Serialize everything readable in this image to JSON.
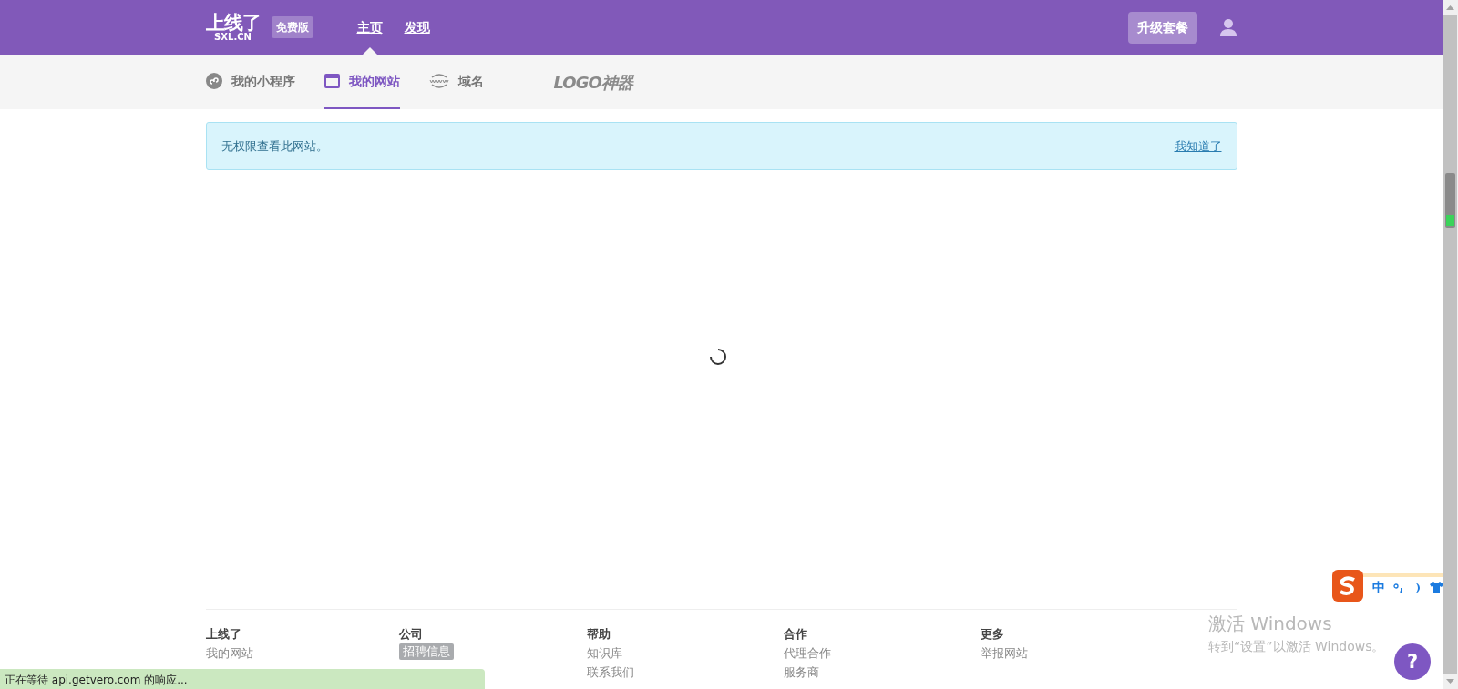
{
  "header": {
    "logo": "上线了",
    "logo_sub": "SXL.CN",
    "plan_badge": "免费版",
    "nav": [
      {
        "label": "主页",
        "selected": true
      },
      {
        "label": "发现",
        "selected": false
      }
    ],
    "upgrade_button": "升级套餐"
  },
  "subnav": {
    "items": [
      {
        "label": "我的小程序",
        "kind": "miniprogram",
        "selected": false
      },
      {
        "label": "我的网站",
        "kind": "website",
        "selected": true
      },
      {
        "label": "域名",
        "kind": "domain",
        "selected": false
      }
    ],
    "logo_tool": "LOGO神器"
  },
  "alert": {
    "message": "无权限查看此网站。",
    "dismiss": "我知道了"
  },
  "footer": {
    "columns": [
      {
        "heading": "上线了",
        "links": [
          {
            "label": "我的网站",
            "highlighted": false
          }
        ]
      },
      {
        "heading": "公司",
        "links": [
          {
            "label": "招聘信息",
            "highlighted": true
          }
        ]
      },
      {
        "heading": "帮助",
        "links": [
          {
            "label": "知识库",
            "highlighted": false
          },
          {
            "label": "联系我们",
            "highlighted": false
          }
        ]
      },
      {
        "heading": "合作",
        "links": [
          {
            "label": "代理合作",
            "highlighted": false
          },
          {
            "label": "服务商",
            "highlighted": false
          }
        ]
      },
      {
        "heading": "更多",
        "links": [
          {
            "label": "举报网站",
            "highlighted": false
          }
        ]
      }
    ]
  },
  "ime_toolbar": {
    "mode": "中"
  },
  "activation_notice": {
    "title": "激活 Windows",
    "message": "转到“设置”以激活 Windows。"
  },
  "help_button": "?",
  "status_bar": "正在等待 api.getvero.com 的响应..."
}
